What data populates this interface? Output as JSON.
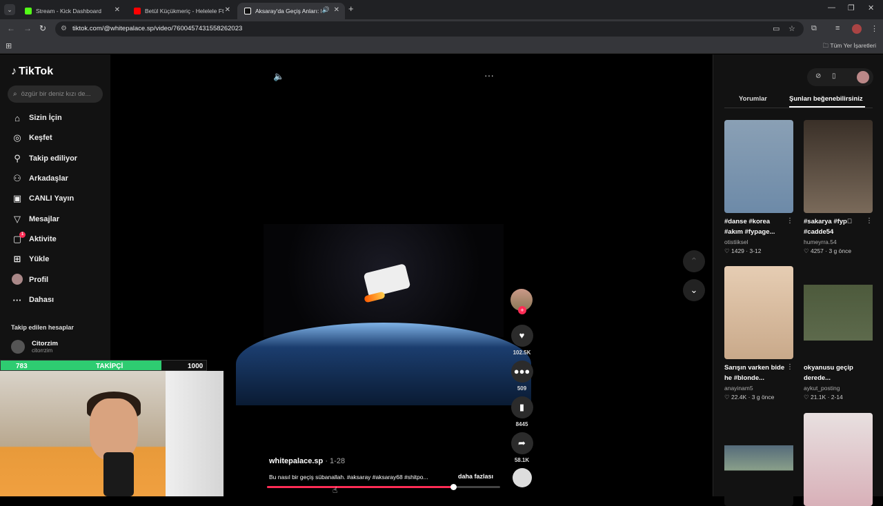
{
  "browser": {
    "tabs": [
      {
        "title": "Stream - Kick Dashboard",
        "color": "#53fc18"
      },
      {
        "title": "Betül Küçükmeriç - Helelele Ft",
        "color": "#ff0000"
      },
      {
        "title": "Aksaray'da Geçiş Anları: Ko",
        "color": "#ffffff"
      }
    ],
    "url": "tiktok.com/@whitepalace.sp/video/7600457431558262023",
    "bookmarks_all": "Tüm Yer İşaretleri"
  },
  "tiktok": {
    "logo": "TikTok",
    "search_placeholder": "özgür bir deniz kızı de...",
    "nav": [
      {
        "label": "Sizin İçin",
        "icon": "home-icon",
        "glyph": "⌂"
      },
      {
        "label": "Keşfet",
        "icon": "compass-icon",
        "glyph": "◎"
      },
      {
        "label": "Takip ediliyor",
        "icon": "user-follow-icon",
        "glyph": "👤"
      },
      {
        "label": "Arkadaşlar",
        "icon": "friends-icon",
        "glyph": "👥"
      },
      {
        "label": "CANLI Yayın",
        "icon": "live-icon",
        "glyph": "▣"
      },
      {
        "label": "Mesajlar",
        "icon": "send-icon",
        "glyph": "▽"
      },
      {
        "label": "Aktivite",
        "icon": "activity-icon",
        "glyph": "▢",
        "badge": "1"
      },
      {
        "label": "Yükle",
        "icon": "upload-icon",
        "glyph": "⊞"
      },
      {
        "label": "Profil",
        "icon": "profile-avatar-icon",
        "glyph": ""
      },
      {
        "label": "Dahası",
        "icon": "more-dots-icon",
        "glyph": "···"
      }
    ],
    "following_title": "Takip edilen hesaplar",
    "following": [
      {
        "name": "Citorzim",
        "handle": "citorrzim"
      }
    ],
    "video": {
      "author": "whitepalace.sp",
      "date": " · 1-28",
      "description": "Bu nasıl bir geçiş sübanallah. #aksaray #aksaray68 #shitpo...",
      "more_label": "daha fazlası",
      "progress": 0.8
    },
    "actions": {
      "likes": "102.5K",
      "comments": "509",
      "saves": "8445",
      "shares": "58.1K"
    },
    "right_panel": {
      "tabs": [
        "Yorumlar",
        "Şunları beğenebilirsiniz"
      ],
      "cards": [
        {
          "title": "#danse #korea #akım #fypage...",
          "user": "otistiiksel",
          "likes": "1429",
          "date": "3-12",
          "color": "#6d8aa8"
        },
        {
          "title": "#sakarya #fyp゚ #cadde54",
          "user": "humeyrra.54",
          "likes": "4257",
          "date": "3 g önce",
          "color": "#5a4a3a"
        },
        {
          "title": "Sarışın varken bide he #blonde...",
          "user": "anayinam5",
          "likes": "22.4K",
          "date": "3 g önce",
          "color": "#c9a98a"
        },
        {
          "title": "okyanusu geçip derede...",
          "user": "aykut_posting",
          "likes": "21.1K",
          "date": "2-14",
          "color": "#4d5a3c"
        },
        {
          "title": "",
          "user": "",
          "likes": "",
          "date": "",
          "color": "#556b7a"
        },
        {
          "title": "",
          "user": "",
          "likes": "",
          "date": "",
          "color": "#d8b0b8"
        }
      ]
    }
  },
  "stream_overlay": {
    "left": "783",
    "label": "TAKİPÇİ",
    "right": "1000",
    "progress": 0.783
  }
}
